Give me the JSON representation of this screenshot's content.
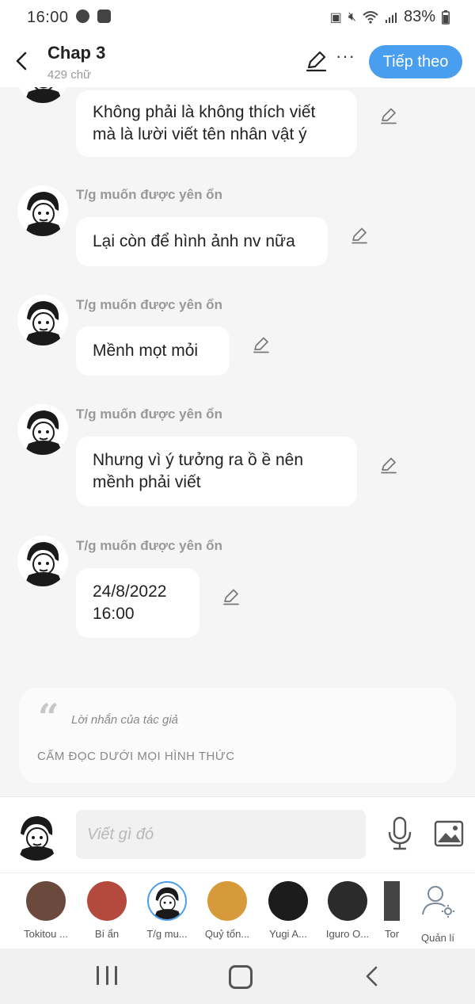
{
  "status_bar": {
    "time": "16:00",
    "battery": "83%"
  },
  "header": {
    "title": "Chap 3",
    "subtitle": "429 chữ",
    "next_label": "Tiếp theo"
  },
  "messages": [
    {
      "sender": "",
      "lines": [
        "Không phải là không thích viết",
        "mà là lười viết tên nhân vật ý"
      ]
    },
    {
      "sender": "T/g muốn được yên ổn",
      "lines": [
        "Lại còn để hình ảnh nv nữa"
      ]
    },
    {
      "sender": "T/g muốn được yên ổn",
      "lines": [
        "Mềnh mọt mỏi"
      ]
    },
    {
      "sender": "T/g muốn được yên ổn",
      "lines": [
        "Nhưng vì ý tưởng ra ồ ề nên",
        "mềnh phải viết"
      ]
    },
    {
      "sender": "T/g muốn được yên ổn",
      "lines": [
        "24/8/2022",
        "16:00"
      ]
    }
  ],
  "author_note": {
    "label": "Lời nhắn của tác giả",
    "text": "CẤM ĐỌC DƯỚI MỌI HÌNH THỨC"
  },
  "composer": {
    "placeholder": "Viết gì đó"
  },
  "characters": [
    {
      "name": "Tokitou ...",
      "color": "#6b4a3d"
    },
    {
      "name": "Bí ẩn",
      "color": "#b44a3e"
    },
    {
      "name": "T/g mu...",
      "color": "#2e2e2e"
    },
    {
      "name": "Quỷ tổn...",
      "color": "#d69a3b"
    },
    {
      "name": "Yugi A...",
      "color": "#1c1c1c"
    },
    {
      "name": "Iguro O...",
      "color": "#2b2b2b"
    },
    {
      "name": "Tor",
      "color": "#444444"
    },
    {
      "name": "Quản lí",
      "color": "#7a8a9a"
    }
  ],
  "colors": {
    "accent": "#4a9eef",
    "background": "#f5f5f5"
  }
}
